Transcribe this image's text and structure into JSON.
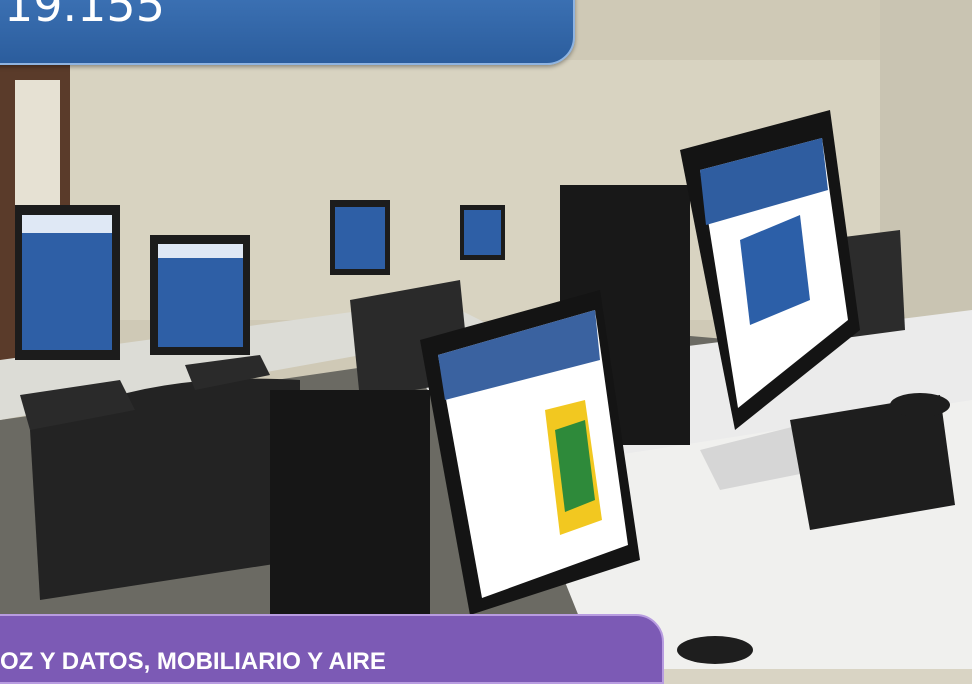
{
  "header": {
    "number_text": "19.155"
  },
  "footer": {
    "caption_text": "OZ Y DATOS, MOBILIARIO Y AIRE"
  },
  "photo": {
    "subject": "computer-lab"
  }
}
